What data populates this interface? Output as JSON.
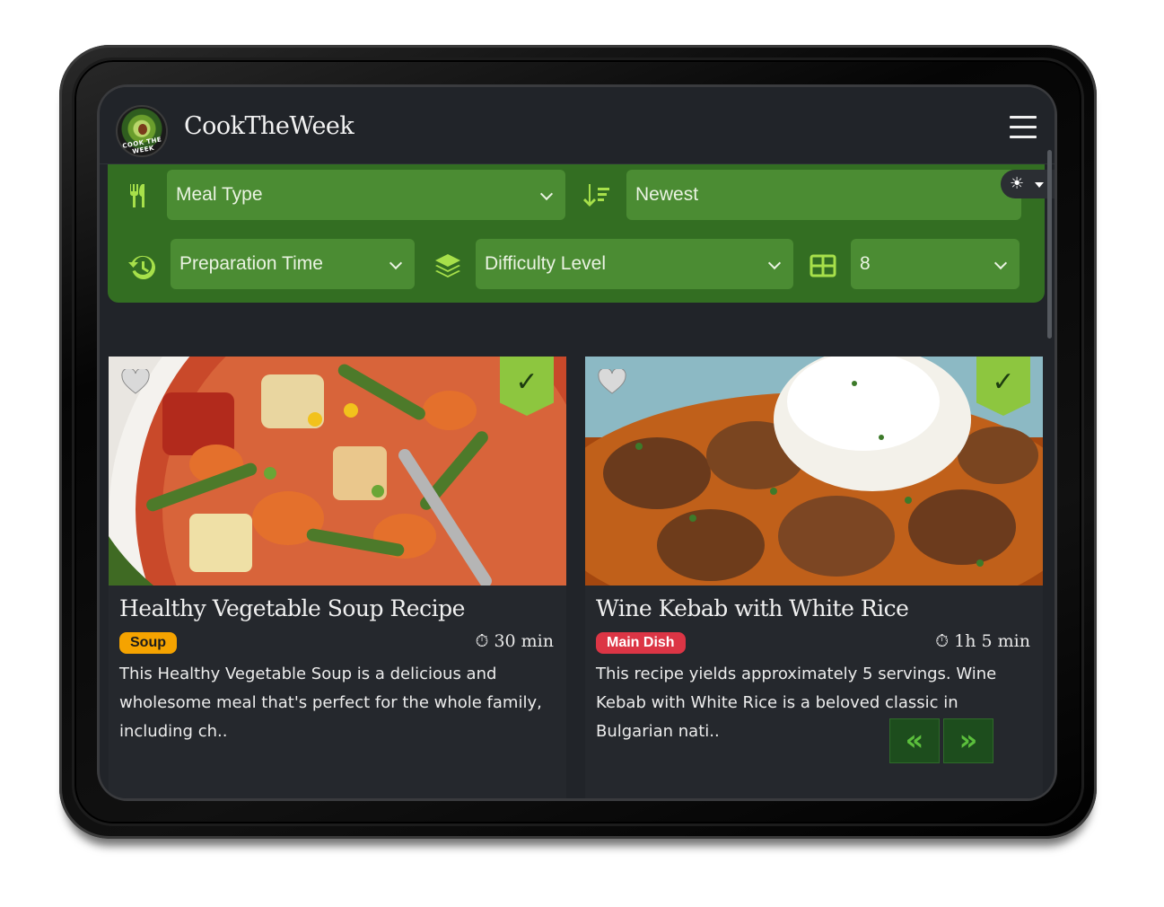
{
  "navbar": {
    "brand": "CookTheWeek",
    "logo_text": "COOK THE WEEK",
    "menu_icon": "hamburger-menu-icon"
  },
  "filters": {
    "meal_type": {
      "label": "Meal Type",
      "icon": "fork-knife-icon"
    },
    "sort": {
      "label": "Newest",
      "icon": "sort-descending-icon"
    },
    "prep_time": {
      "label": "Preparation Time",
      "icon": "history-clock-icon"
    },
    "difficulty": {
      "label": "Difficulty Level",
      "icon": "layers-icon"
    },
    "per_page": {
      "label": "8",
      "icon": "grid-icon"
    },
    "theme_icon": "sun-icon"
  },
  "colors": {
    "panel_green": "#336e22",
    "select_green": "#4b8c33",
    "accent_lime": "#8dc63f",
    "soup_badge": "#f5a300",
    "main_dish_badge": "#dc3545",
    "background": "#212429"
  },
  "recipes": [
    {
      "title": "Healthy Vegetable Soup Recipe",
      "category": "Soup",
      "time": "30 min",
      "description": "This Healthy Vegetable Soup is a delicious and wholesome meal that's perfect for the whole family, including ch..",
      "badge_color": "#f5a300",
      "badge_text_color": "#1b1b1b"
    },
    {
      "title": "Wine Kebab with White Rice",
      "category": "Main Dish",
      "time": "1h 5 min",
      "description": "This recipe yields approximately 5 servings. Wine Kebab with White Rice is a beloved classic in Bulgarian nati..",
      "badge_color": "#dc3545",
      "badge_text_color": "#ffffff"
    }
  ],
  "pagination": {
    "prev": "«",
    "next": "»"
  }
}
